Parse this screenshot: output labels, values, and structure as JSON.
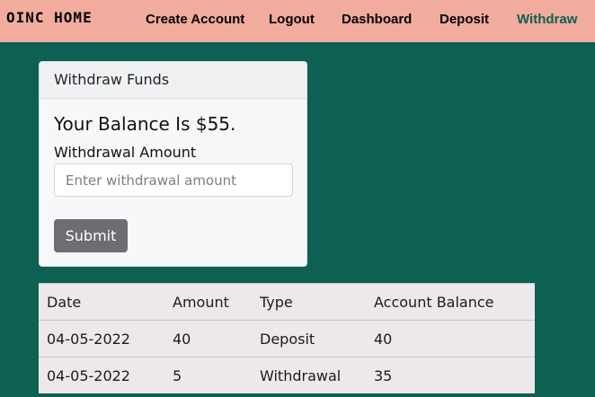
{
  "nav": {
    "brand": "OINC HOME",
    "links": [
      "Create Account",
      "Logout",
      "Dashboard",
      "Deposit",
      "Withdraw"
    ],
    "active": "Withdraw",
    "accent": "#0d6153",
    "background": "#f1ac9d"
  },
  "card": {
    "title": "Withdraw Funds",
    "balance_text": "Your Balance Is $55.",
    "amount_label": "Withdrawal Amount",
    "amount_value": "",
    "amount_placeholder": "Enter withdrawal amount",
    "submit_label": "Submit"
  },
  "history": {
    "headers": [
      "Date",
      "Amount",
      "Type",
      "Account Balance"
    ],
    "rows": [
      [
        "04-05-2022",
        "40",
        "Deposit",
        "40"
      ],
      [
        "04-05-2022",
        "5",
        "Withdrawal",
        "35"
      ]
    ]
  },
  "colors": {
    "page_background": "#0d6153",
    "table_background": "#ede9ea",
    "button_background": "#6c6e71"
  }
}
